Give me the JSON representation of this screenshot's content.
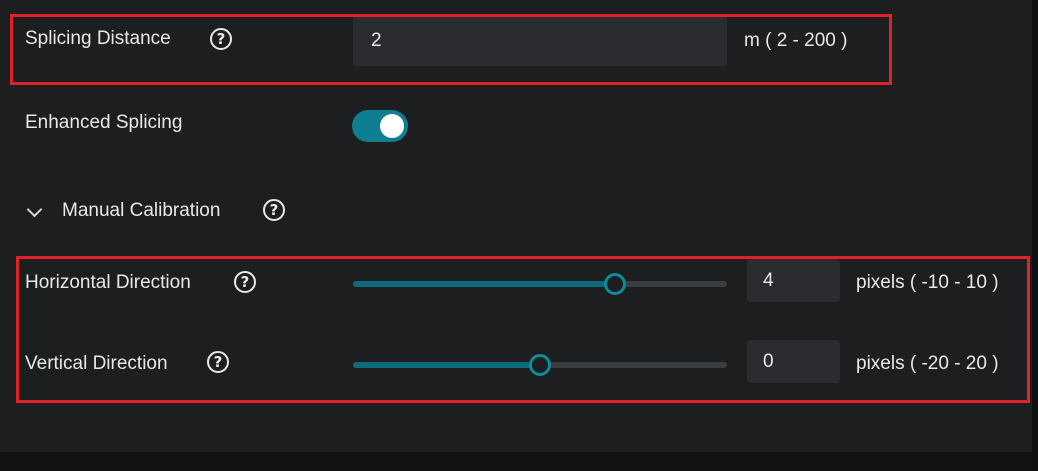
{
  "splicing_distance": {
    "label": "Splicing Distance",
    "value": "2",
    "unit": "m ( 2 - 200 )",
    "help_icon": "question-circle-icon"
  },
  "enhanced_splicing": {
    "label": "Enhanced Splicing",
    "enabled": true
  },
  "manual_calibration": {
    "label": "Manual Calibration",
    "expanded": true,
    "chevron_icon": "chevron-down-icon",
    "help_icon": "question-circle-icon",
    "horizontal": {
      "label": "Horizontal Direction",
      "value": "4",
      "unit": "pixels ( -10 - 10 )",
      "min": -10,
      "max": 10
    },
    "vertical": {
      "label": "Vertical Direction",
      "value": "0",
      "unit": "pixels ( -20 - 20 )",
      "min": -20,
      "max": 20
    }
  },
  "colors": {
    "accent": "#0e7f90",
    "highlight": "#e0202a",
    "background": "#1c1e20"
  }
}
